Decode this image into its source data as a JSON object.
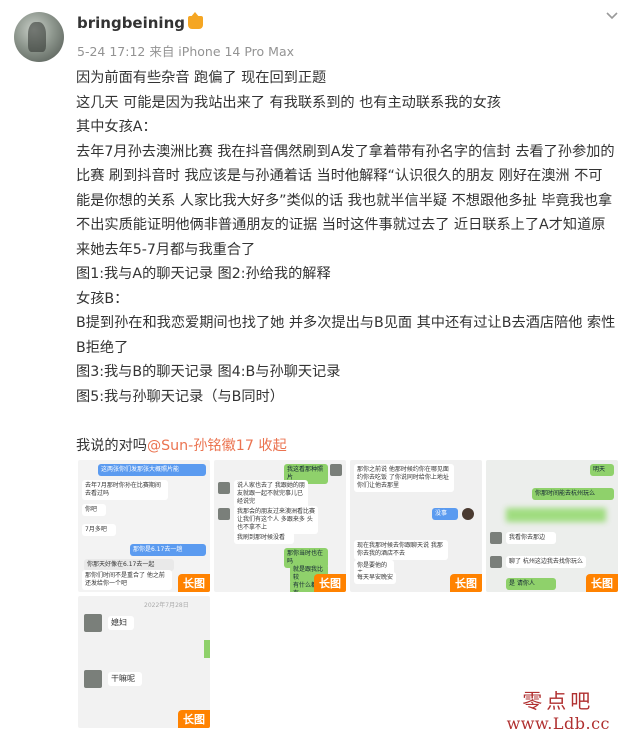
{
  "post": {
    "username": "bringbeining",
    "meta": "5-24 17:12  来自 iPhone 14 Pro Max",
    "lines": [
      "因为前面有些杂音 跑偏了 现在回到正题",
      "这几天 可能是因为我站出来了 有我联系到的 也有主动联系我的女孩",
      "其中女孩A：",
      "去年7月孙去澳洲比赛  我在抖音偶然刷到A发了拿着带有孙名字的信封 去看了孙参加的比赛 刷到抖音时  我应该是与孙通着话 当时他解释“认识很久的朋友 刚好在澳洲 不可能是你想的关系 人家比我大好多”类似的话 我也就半信半疑 不想跟他多扯 毕竟我也拿不出实质能证明他俩非普通朋友的证据 当时这件事就过去了 近日联系上了A才知道原来她去年5-7月都与我重合了",
      "图1:我与A的聊天记录  图2:孙给我的解释",
      "女孩B：",
      "B提到孙在和我恋爱期间也找了她 并多次提出与B见面 其中还有过让B去酒店陪他 索性B拒绝了",
      "图3:我与B的聊天记录   图4:B与孙聊天记录",
      "图5:我与孙聊天记录（与B同时）"
    ],
    "closing_prefix": "我说的对吗",
    "mention": "@Sun-孙铭徽17",
    "collapse": "收起"
  },
  "images": {
    "tag": "长图",
    "img1": {
      "b1": "这两张你们发那张大概照片能",
      "b2": "去年7月那时你孙在比赛期间去看过吗",
      "b3": "你吧",
      "b4": "7月多吧",
      "b5": "那你是6.17去一趟",
      "b6": "你那天好像在6.17去一起",
      "b7": "那你们时间不是重合了 他之前还发给你一个吧"
    },
    "img2": {
      "b1": "我这看那种照片",
      "b2": "说人家也去了 我跟她的朋友就跟一起不就完事儿已经说完",
      "b3": "我那会的朋友过来澳洲看比赛 让我们有这个人 多跟来多 头也不拿不上",
      "b4": "我刷到那时候没看",
      "b5": "那你当时也在吗",
      "b6": "就是跟我比较",
      "b7": "有什么都没有"
    },
    "img3": {
      "b1": "那你之前说 他那时候约你在哪见面约你去吃饭 了你说同时给你上地址你们让他去那里",
      "b2": "没事",
      "b3": "现在我那时候去你跟聊天说 我那你去我的酒店不去",
      "b4": "你是要他的去",
      "b5": "每天早安晚安"
    },
    "img4": {
      "b1": "明天",
      "b2": "你那时间能去杭州玩么",
      "b3": "我看你去那边",
      "b4": "聊了 杭州这边我去找你玩么",
      "b5": "是 请你人"
    },
    "img5": {
      "date": "2022年7月28日",
      "b1": "媳妇",
      "b2": "干嘛呢"
    }
  },
  "watermark": {
    "cn": "零点吧",
    "url": "www.Ldb.cc"
  }
}
